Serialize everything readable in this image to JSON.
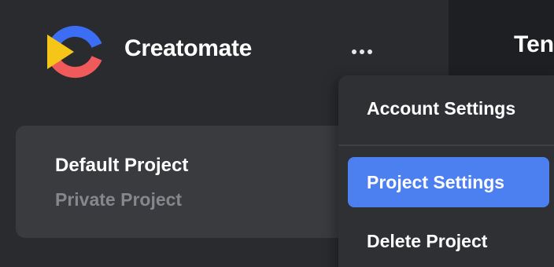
{
  "header": {
    "app_name": "Creatomate",
    "logo_icon": "creatomate-logo-icon",
    "more_icon": "more-horizontal-icon",
    "main_title_partial": "Ten"
  },
  "project": {
    "name": "Default Project",
    "type": "Private Project"
  },
  "menu": {
    "items": [
      {
        "label": "Account Settings",
        "active": false
      },
      {
        "label": "Project Settings",
        "active": true
      },
      {
        "label": "Delete Project",
        "active": false
      }
    ]
  },
  "colors": {
    "background": "#2a2b2f",
    "card": "#3a3b3f",
    "menu": "#2f3034",
    "accent": "#4c7ff0",
    "logo_blue": "#3b6ef5",
    "logo_red": "#f05a5a",
    "logo_yellow": "#f5c518"
  }
}
